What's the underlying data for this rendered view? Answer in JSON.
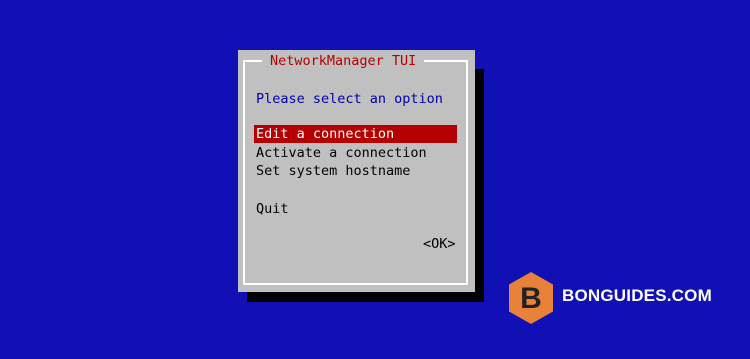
{
  "app": {
    "title": "NetworkManager TUI",
    "prompt": "Please select an option"
  },
  "menu": {
    "items": [
      {
        "label": "Edit a connection",
        "selected": true
      },
      {
        "label": "Activate a connection",
        "selected": false
      },
      {
        "label": "Set system hostname",
        "selected": false
      },
      {
        "label": "Quit",
        "selected": false
      }
    ]
  },
  "buttons": {
    "ok_label": "<OK>"
  },
  "watermark": {
    "letter": "B",
    "text": "BONGUIDES.COM"
  },
  "colors": {
    "background": "#1010b4",
    "dialog": "#c0c0c0",
    "title": "#b40000",
    "highlight": "#b40000",
    "prompt": "#0000a8",
    "logo": "#e8823a"
  }
}
